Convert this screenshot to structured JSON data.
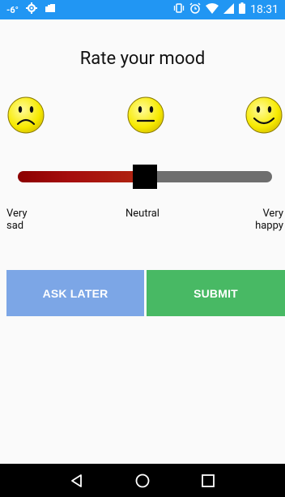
{
  "status_bar": {
    "temperature": "-6°",
    "time": "18:31",
    "icons": [
      "weather-icon",
      "settings-icon",
      "gallery-icon",
      "vibrate-icon",
      "alarm-icon",
      "wifi-icon",
      "signal-icon",
      "battery-icon"
    ]
  },
  "colors": {
    "status_bar": "#2196f3",
    "slider_fill": "#a50d0d",
    "slider_rest": "#6e6e6e",
    "ask_later": "#7ca6e6",
    "submit": "#48b964"
  },
  "title": "Rate your mood",
  "faces": [
    "sad-face-icon",
    "neutral-face-icon",
    "happy-face-icon"
  ],
  "slider": {
    "value": 0.5
  },
  "labels": {
    "sad_line1": "Very",
    "sad_line2": "sad",
    "neutral": "Neutral",
    "happy_line1": "Very",
    "happy_line2": "happy"
  },
  "buttons": {
    "ask_later": "ASK LATER",
    "submit": "SUBMIT"
  },
  "nav": [
    "back-icon",
    "home-icon",
    "recents-icon"
  ]
}
